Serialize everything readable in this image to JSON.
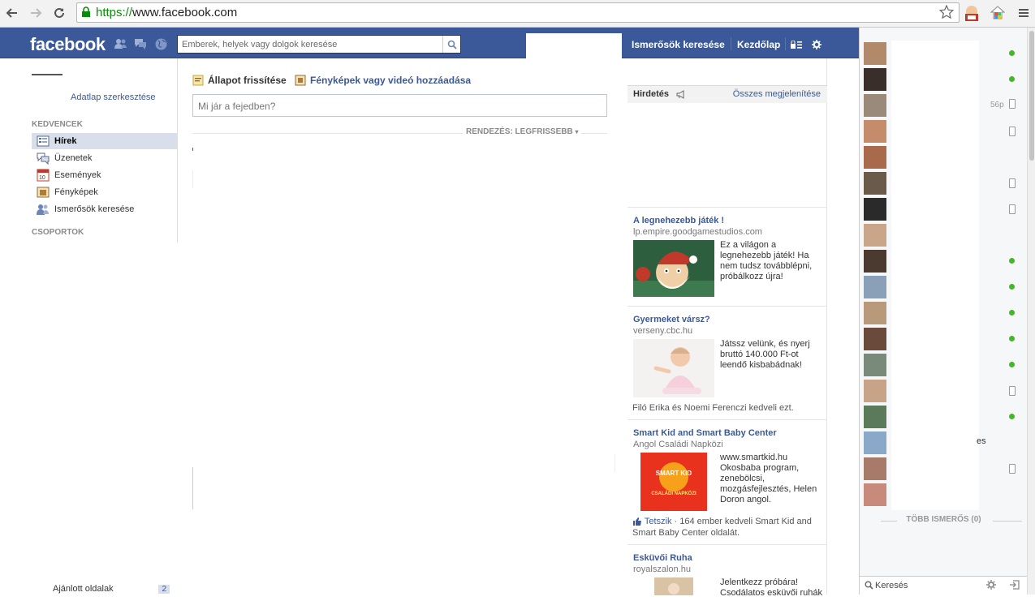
{
  "browser": {
    "url_scheme": "https://",
    "url_host": "www.facebook.com"
  },
  "topbar": {
    "logo": "facebook",
    "search_placeholder": "Emberek, helyek vagy dolgok keresése",
    "find_friends": "Ismerősök keresése",
    "home": "Kezdőlap",
    "brand_color": "#3b5998"
  },
  "left": {
    "profile_name": "",
    "edit_profile": "Adatlap szerkesztése",
    "favorites_heading": "KEDVENCEK",
    "favorites": [
      {
        "label": "Hírek",
        "icon": "news-feed-icon",
        "active": true
      },
      {
        "label": "Üzenetek",
        "icon": "messages-icon",
        "active": false
      },
      {
        "label": "Események",
        "icon": "events-icon",
        "active": false
      },
      {
        "label": "Fényképek",
        "icon": "photos-icon",
        "active": false
      },
      {
        "label": "Ismerősök keresése",
        "icon": "find-friends-icon",
        "active": false
      }
    ],
    "groups_heading": "CSOPORTOK",
    "suggested_pages_label": "Ajánlott oldalak",
    "suggested_pages_count": "2"
  },
  "composer": {
    "status_tab": "Állapot frissítése",
    "photo_tab": "Fényképek vagy videó hozzáadása",
    "placeholder": "Mi jár a fejedben?",
    "sort_label": "RENDEZÉS: LEGFRISSEBB"
  },
  "ads": {
    "heading": "Hirdetés",
    "show_all": "Összes megjelenítése",
    "items": [
      {
        "title": "A legnehezebb játék !",
        "domain": "lp.empire.goodgamestudios.com",
        "body": "Ez a világon a legnehezebb játék! Ha nem tudsz továbblépni, próbálkozz újra!"
      },
      {
        "title": "Gyermeket vársz?",
        "domain": "verseny.cbc.hu",
        "body": "Játssz velünk, és nyerj bruttó 140.000 Ft-ot leendő kisbabádnak!",
        "social": "Filó Erika és Noemi Ferenczi kedveli ezt."
      },
      {
        "title": "Smart Kid and Smart Baby Center",
        "domain": "Angol Családi Napközi",
        "body": "www.smartkid.hu Okosbaba program, zenebölcsi, mozgásfejlesztés, Helen Doron angol.",
        "like_label": "Tetszik",
        "social": " · 164 ember kedveli Smart Kid and Smart Baby Center oldalát.",
        "image_text_1": "SMART KID",
        "image_text_2": "CSALÁDI NAPKÖZI"
      },
      {
        "title": "Esküvői Ruha",
        "domain": "royalszalon.hu",
        "body": "Jelentkezz próbára! Csodálatos esküvői ruhák"
      }
    ]
  },
  "chat": {
    "idle_time": "56p",
    "partial_name": "es",
    "more_friends": "TÖBB ISMERŐS (0)",
    "search_label": "Keresés",
    "online_color": "#42b72a"
  }
}
